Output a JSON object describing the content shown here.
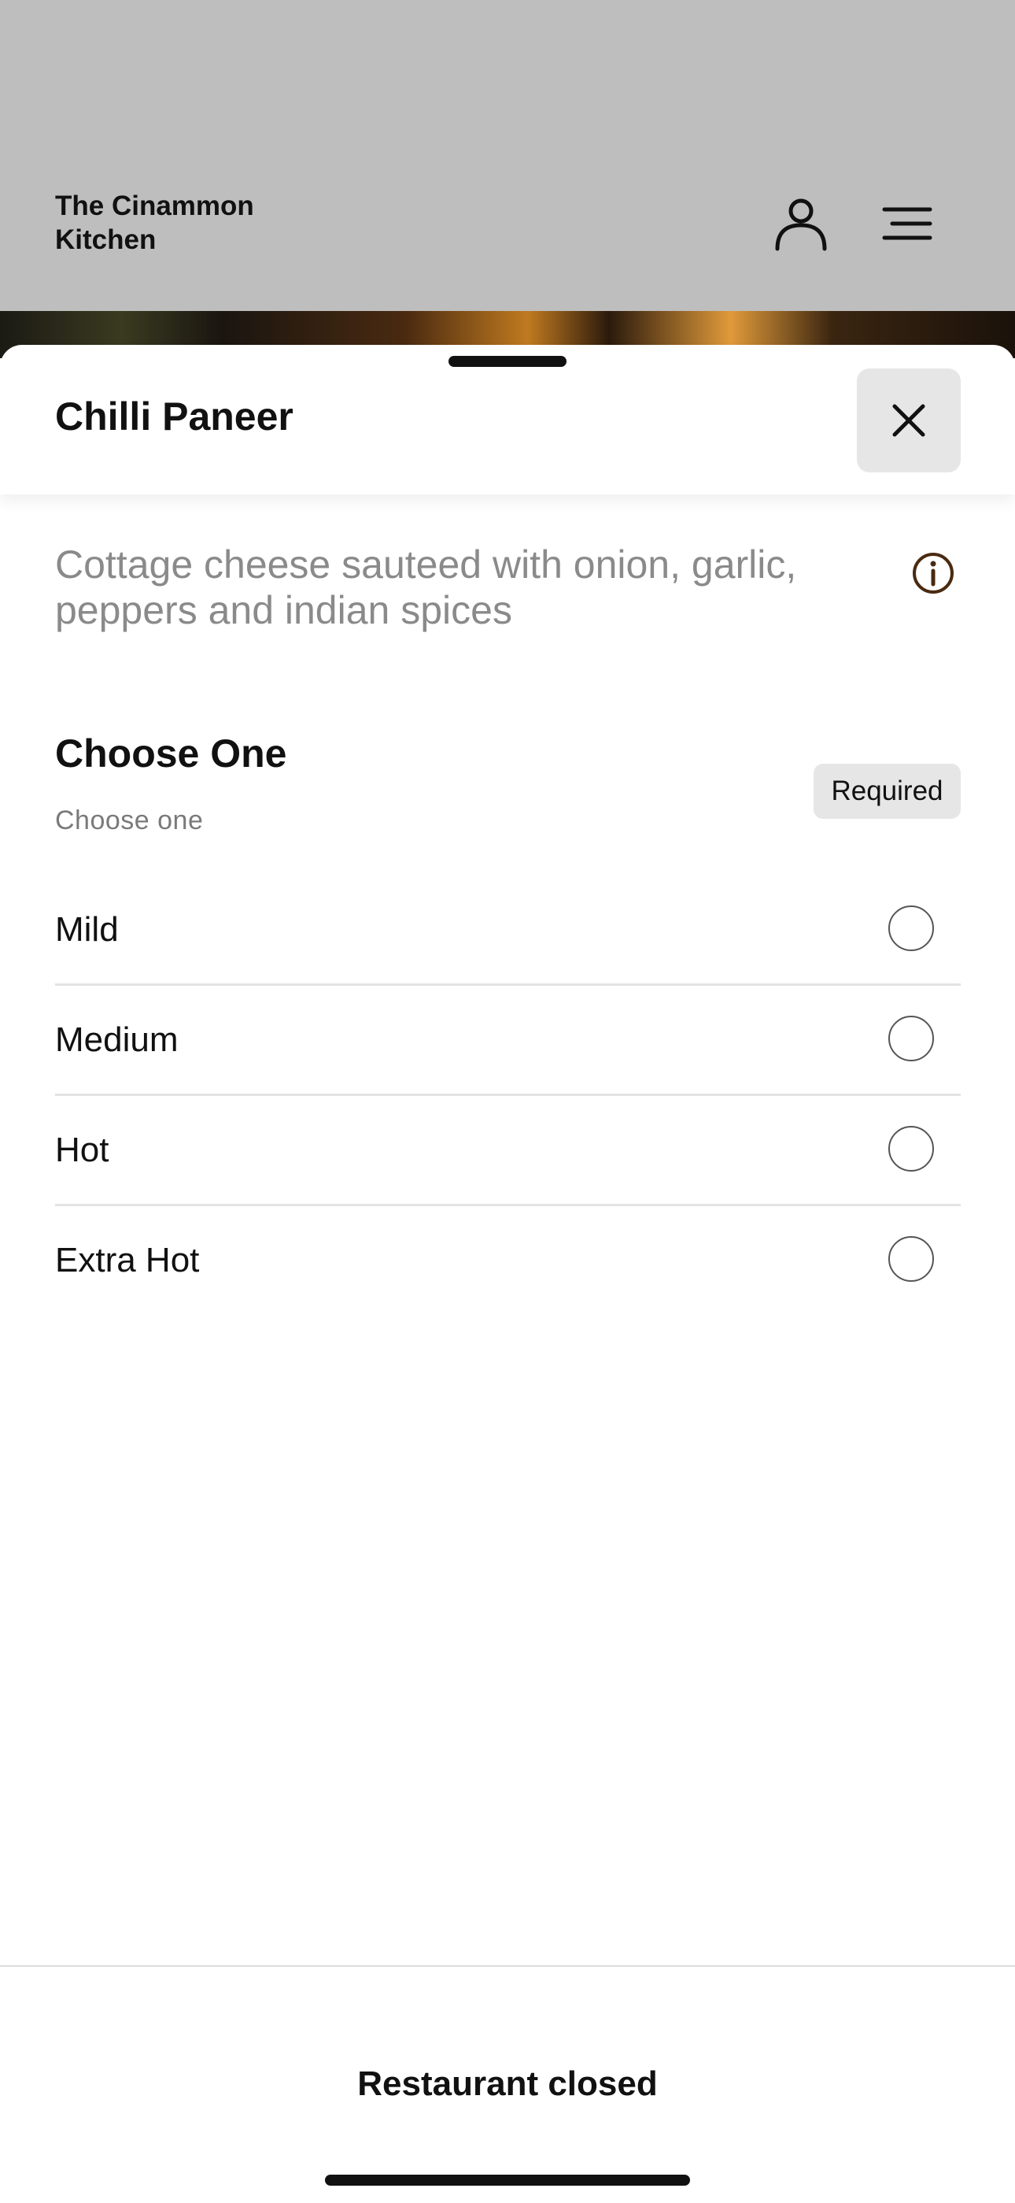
{
  "header": {
    "brand": "The Cinammon\nKitchen",
    "icons": [
      "user-icon",
      "menu-icon"
    ]
  },
  "sheet": {
    "title": "Chilli Paneer",
    "close_icon": "close-icon",
    "description": "Cottage cheese sauteed with onion, garlic, peppers and indian spices",
    "info_icon": "info-icon",
    "modifier_group": {
      "title": "Choose One",
      "subtitle": "Choose one",
      "badge": "Required",
      "options": [
        {
          "label": "Mild",
          "selected": false
        },
        {
          "label": "Medium",
          "selected": false
        },
        {
          "label": "Hot",
          "selected": false
        },
        {
          "label": "Extra Hot",
          "selected": false
        }
      ]
    }
  },
  "footer": {
    "status": "Restaurant closed"
  },
  "colors": {
    "overlay_header": "#bebebe",
    "badge_bg": "#e6e6e6",
    "info_icon": "#4a2a10"
  }
}
